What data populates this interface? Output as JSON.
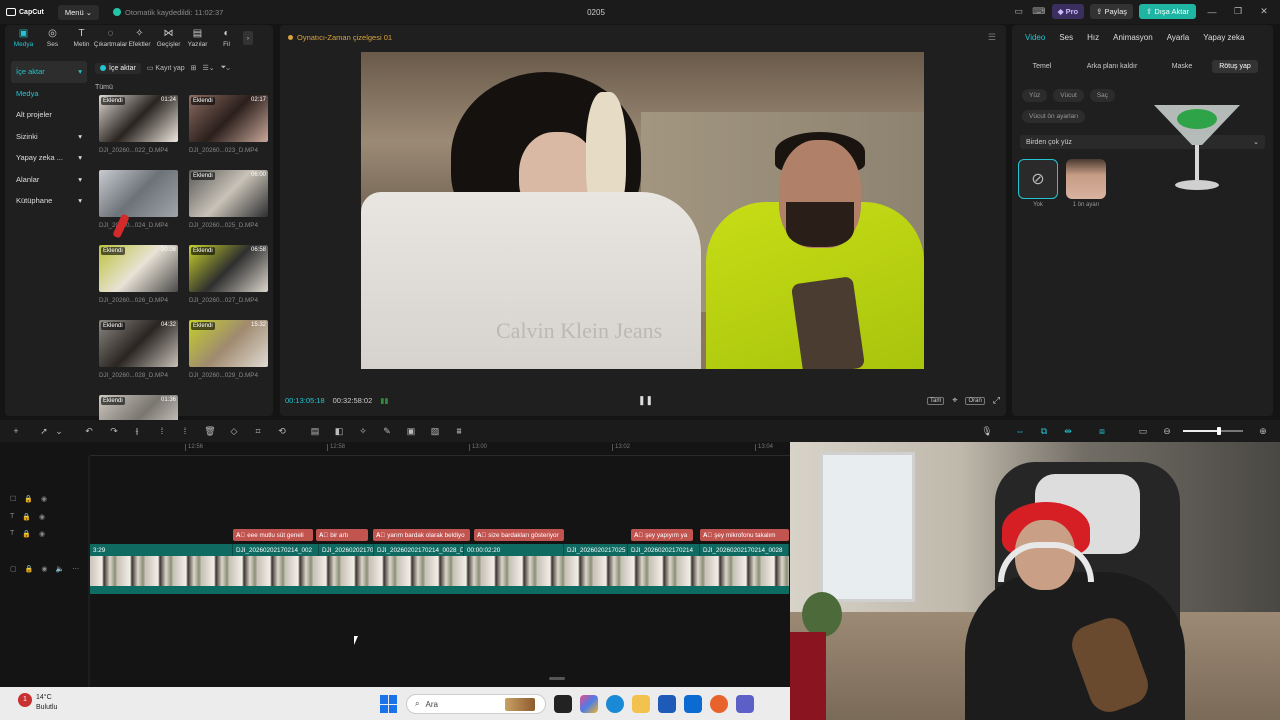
{
  "app": {
    "project_name": "0205",
    "menu_label": "Menü",
    "autosave_text": "Otomatik kaydedildi: 11:02:37",
    "logo_text": "CapCut",
    "pro_label": "Pro",
    "share_label": "Paylaş",
    "export_label": "Dışa Aktar"
  },
  "left_tabs": [
    {
      "label": "Medya",
      "icon": "media-icon"
    },
    {
      "label": "Ses",
      "icon": "audio-icon"
    },
    {
      "label": "Metin",
      "icon": "text-icon"
    },
    {
      "label": "Çıkartmalar",
      "icon": "sticker-icon"
    },
    {
      "label": "Efektler",
      "icon": "effects-icon"
    },
    {
      "label": "Geçişler",
      "icon": "transitions-icon"
    },
    {
      "label": "Yazılar",
      "icon": "captions-icon"
    },
    {
      "label": "Fil",
      "icon": "filters-icon"
    }
  ],
  "media_sidebar": [
    {
      "label": "İçe aktar",
      "chevron": "▾"
    },
    {
      "label": "Medya",
      "chevron": ""
    },
    {
      "label": "Alt projeler",
      "chevron": ""
    },
    {
      "label": "Sizinki",
      "chevron": "▾"
    },
    {
      "label": "Yapay zeka ...",
      "chevron": "▾"
    },
    {
      "label": "Alanlar",
      "chevron": "▾"
    },
    {
      "label": "Kütüphane",
      "chevron": "▾"
    }
  ],
  "media_tools": {
    "import_label": "İçe aktar",
    "record_label": "Kayıt yap",
    "all_label": "Tümü"
  },
  "media_items": [
    {
      "badge": "Eklendi",
      "duration": "01:24",
      "name": "DJI_20260...022_D.MP4",
      "colors": [
        "#ddd8d0",
        "#2a2420",
        "#efe9e0"
      ]
    },
    {
      "badge": "Eklendi",
      "duration": "02:17",
      "name": "DJI_20260...023_D.MP4",
      "colors": [
        "#8a6b60",
        "#2b1f1c",
        "#c9a89a"
      ]
    },
    {
      "badge": "",
      "duration": "",
      "name": "DJI_20260...024_D.MP4",
      "colors": [
        "#c8ccd0",
        "#6d7278",
        "#a0a5aa"
      ]
    },
    {
      "badge": "Eklendi",
      "duration": "06:00",
      "name": "DJI_20260...025_D.MP4",
      "colors": [
        "#5a5a58",
        "#c9c3b8",
        "#2d2e30"
      ]
    },
    {
      "badge": "Eklendi",
      "duration": "00:08",
      "name": "DJI_20260...026_D.MP4",
      "colors": [
        "#bcc23a",
        "#e8e2d6",
        "#4a4a48"
      ]
    },
    {
      "badge": "Eklendi",
      "duration": "06:58",
      "name": "DJI_20260...027_D.MP4",
      "colors": [
        "#c8d22a",
        "#2f2f2f",
        "#dcd6cc"
      ]
    },
    {
      "badge": "Eklendi",
      "duration": "04:32",
      "name": "DJI_20260...028_D.MP4",
      "colors": [
        "#8a8680",
        "#2a2522",
        "#c8c2b8"
      ]
    },
    {
      "badge": "Eklendi",
      "duration": "15:32",
      "name": "DJI_20260...029_D.MP4",
      "colors": [
        "#c4d02a",
        "#a08a70",
        "#e0dbd2"
      ]
    },
    {
      "badge": "Eklendi",
      "duration": "01:36",
      "name": "",
      "colors": [
        "#ccc8c0",
        "#7a7670",
        "#e6e2da"
      ]
    }
  ],
  "preview": {
    "title": "Oynatıcı-Zaman çizelgesi 01",
    "current_time": "00:13:05:18",
    "total_time": "00:32:58:02",
    "video_text": "Calvin Klein Jeans",
    "full_label": "Tam",
    "ratio_label": "Oran"
  },
  "right_tabs": [
    "Video",
    "Ses",
    "Hız",
    "Animasyon",
    "Ayarla",
    "Yapay zeka"
  ],
  "right_subtabs": [
    "Temel",
    "Arka planı kaldır",
    "Maske",
    "Rötuş yap"
  ],
  "retouch": {
    "chips": [
      "Yüz",
      "Vücut",
      "Saç"
    ],
    "body_preset": "Vücut ön ayarları",
    "multi_face": "Birden çok yüz",
    "face_options": [
      {
        "label": "Yok"
      },
      {
        "label": "1 ön ayarı"
      }
    ]
  },
  "timeline": {
    "ruler_ticks": [
      "12:56",
      "12:58",
      "13:00",
      "13:02",
      "13:04"
    ],
    "captions": [
      {
        "text": "eee mutlu süt geneli",
        "color": "#c25450"
      },
      {
        "text": "bir artı",
        "color": "#c25450"
      },
      {
        "text": "yarım bardak olarak beldiyo",
        "color": "#c25450"
      },
      {
        "text": "size bardakları gösteriyor",
        "color": "#c25450"
      },
      {
        "text": "şey yapıyım ya",
        "color": "#c25450"
      },
      {
        "text": "şey mikrofonu takalım",
        "color": "#c25450"
      }
    ],
    "clips": [
      "3:29",
      "DJI_20260202170214_002",
      "DJI_20260202170",
      "DJI_20260202170214_0028_D.MP4",
      "00:00:02:20",
      "DJI_2026020217025",
      "DJI_20260202170214",
      "DJI_20260202170214_0028"
    ]
  },
  "taskbar": {
    "temperature": "14°C",
    "weather": "Bulutlu",
    "notification": "1",
    "search_placeholder": "Ara"
  },
  "colors": {
    "accent": "#22c5d1",
    "export": "#1fb5a3",
    "caption": "#c25450",
    "track": "#117d73",
    "pro": "#3a2f5e"
  }
}
